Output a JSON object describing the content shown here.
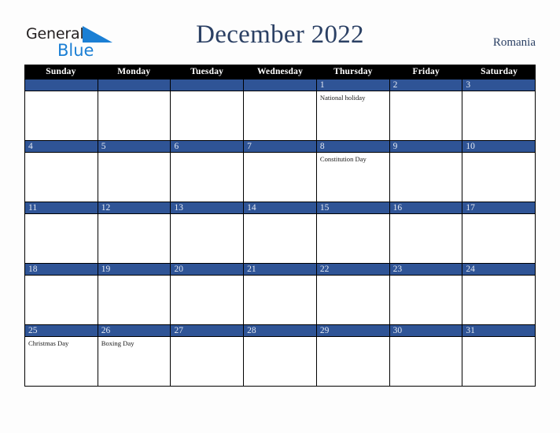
{
  "brand": {
    "word_one": "General",
    "word_two": "Blue",
    "triangle_color": "#1b7fd4",
    "text_color": "#231f20"
  },
  "header": {
    "title": "December 2022",
    "country": "Romania",
    "title_color": "#2b4064"
  },
  "calendar": {
    "day_headers": [
      "Sunday",
      "Monday",
      "Tuesday",
      "Wednesday",
      "Thursday",
      "Friday",
      "Saturday"
    ],
    "header_bg": "#000000",
    "header_text_color": "#ffffff",
    "daybar_color": "#2f5496",
    "daynum_color": "#e4e9f2",
    "cell_bg": "#ffffff",
    "weeks": [
      [
        {
          "day": "",
          "events": []
        },
        {
          "day": "",
          "events": []
        },
        {
          "day": "",
          "events": []
        },
        {
          "day": "",
          "events": []
        },
        {
          "day": "1",
          "events": [
            "National holiday"
          ]
        },
        {
          "day": "2",
          "events": []
        },
        {
          "day": "3",
          "events": []
        }
      ],
      [
        {
          "day": "4",
          "events": []
        },
        {
          "day": "5",
          "events": []
        },
        {
          "day": "6",
          "events": []
        },
        {
          "day": "7",
          "events": []
        },
        {
          "day": "8",
          "events": [
            "Constitution Day"
          ]
        },
        {
          "day": "9",
          "events": []
        },
        {
          "day": "10",
          "events": []
        }
      ],
      [
        {
          "day": "11",
          "events": []
        },
        {
          "day": "12",
          "events": []
        },
        {
          "day": "13",
          "events": []
        },
        {
          "day": "14",
          "events": []
        },
        {
          "day": "15",
          "events": []
        },
        {
          "day": "16",
          "events": []
        },
        {
          "day": "17",
          "events": []
        }
      ],
      [
        {
          "day": "18",
          "events": []
        },
        {
          "day": "19",
          "events": []
        },
        {
          "day": "20",
          "events": []
        },
        {
          "day": "21",
          "events": []
        },
        {
          "day": "22",
          "events": []
        },
        {
          "day": "23",
          "events": []
        },
        {
          "day": "24",
          "events": []
        }
      ],
      [
        {
          "day": "25",
          "events": [
            "Christmas Day"
          ]
        },
        {
          "day": "26",
          "events": [
            "Boxing Day"
          ]
        },
        {
          "day": "27",
          "events": []
        },
        {
          "day": "28",
          "events": []
        },
        {
          "day": "29",
          "events": []
        },
        {
          "day": "30",
          "events": []
        },
        {
          "day": "31",
          "events": []
        }
      ]
    ]
  }
}
